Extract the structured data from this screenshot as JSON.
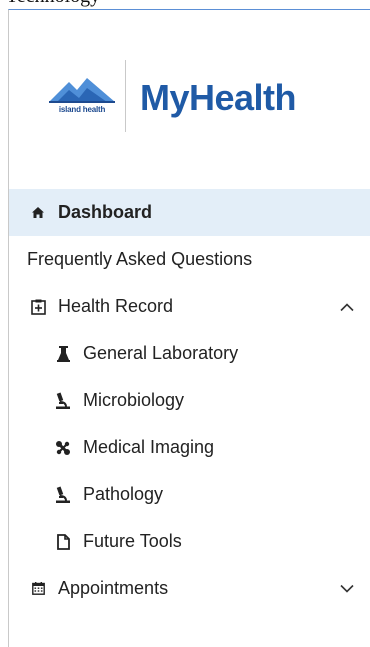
{
  "top_text": "Technology",
  "brand": {
    "org_name": "island health",
    "app_name": "MyHealth",
    "primary_color": "#1f5aa6",
    "org_color": "#1d4a8f",
    "active_bg": "#e3eef8"
  },
  "nav": {
    "dashboard": {
      "label": "Dashboard",
      "icon": "home-icon",
      "active": true
    },
    "faq": {
      "label": "Frequently Asked Questions"
    },
    "health_record": {
      "label": "Health Record",
      "icon": "medical-record-icon",
      "expanded": true,
      "chevron": "chevron-up-icon",
      "children": [
        {
          "label": "General Laboratory",
          "icon": "flask-icon"
        },
        {
          "label": "Microbiology",
          "icon": "microscope-icon"
        },
        {
          "label": "Medical Imaging",
          "icon": "x-ray-icon"
        },
        {
          "label": "Pathology",
          "icon": "microscope-icon"
        },
        {
          "label": "Future Tools",
          "icon": "file-icon"
        }
      ]
    },
    "appointments": {
      "label": "Appointments",
      "icon": "calendar-icon",
      "expanded": false,
      "chevron": "chevron-down-icon"
    }
  }
}
